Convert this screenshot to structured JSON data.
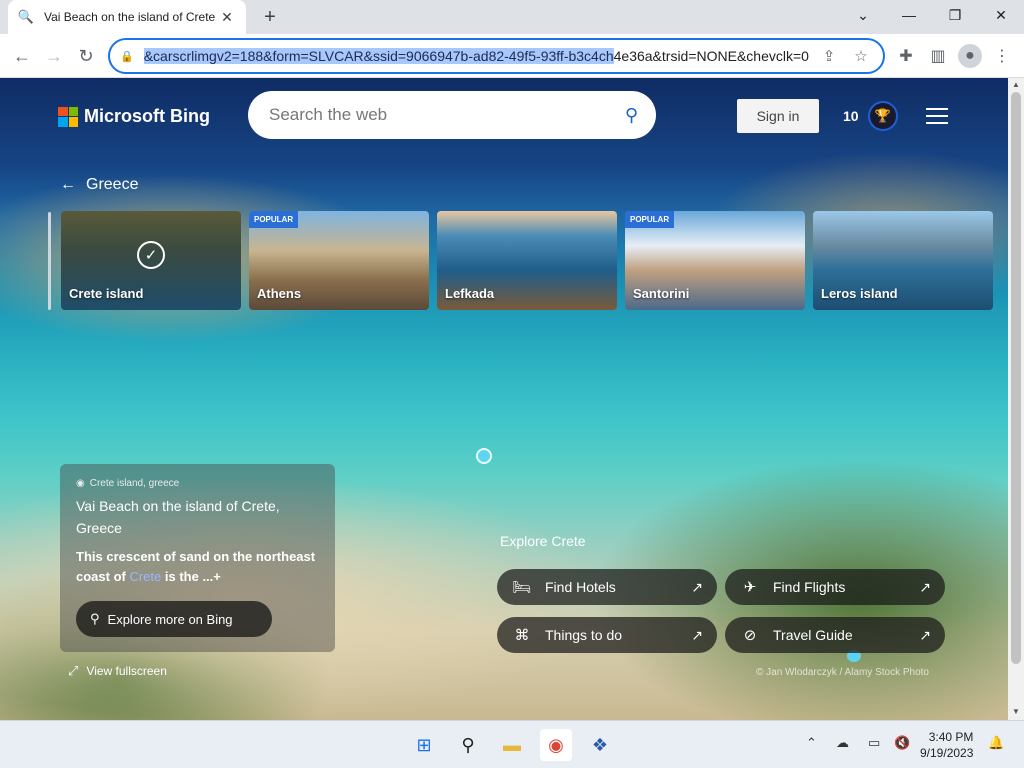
{
  "browser": {
    "tab_title": "Vai Beach on the island of Crete",
    "new_tab": "+",
    "url_selected": "&carscrlimgv2=188&form=SLVCAR&ssid=9066947b-ad82-49f5-93ff-b3c4ch",
    "url_rest": "4e36a&trsid=NONE&chevclk=0"
  },
  "bing": {
    "logo_text": "Microsoft Bing",
    "search_placeholder": "Search the web",
    "signin_label": "Sign in",
    "points": "10"
  },
  "carousel": {
    "title": "Greece",
    "items": [
      {
        "label": "Crete island",
        "badge": ""
      },
      {
        "label": "Athens",
        "badge": "POPULAR"
      },
      {
        "label": "Lefkada",
        "badge": ""
      },
      {
        "label": "Santorini",
        "badge": "POPULAR"
      },
      {
        "label": "Leros island",
        "badge": ""
      }
    ]
  },
  "info": {
    "location": "Crete island, greece",
    "title": "Vai Beach on the island of Crete, Greece",
    "desc_before": "This crescent of sand on the northeast coast of ",
    "desc_link": "Crete",
    "desc_after": " is the ...",
    "desc_more": "+",
    "explore_label": "Explore more on Bing",
    "fullscreen_label": "View fullscreen"
  },
  "explore": {
    "heading": "Explore Crete",
    "buttons": [
      {
        "label": "Find Hotels",
        "icon": "bed-icon"
      },
      {
        "label": "Find Flights",
        "icon": "plane-icon"
      },
      {
        "label": "Things to do",
        "icon": "binoculars-icon"
      },
      {
        "label": "Travel Guide",
        "icon": "compass-icon"
      }
    ]
  },
  "credit": "© Jan Wlodarczyk / Alamy Stock Photo",
  "taskbar": {
    "time": "3:40 PM",
    "date": "9/19/2023"
  },
  "colors": {
    "accent": "#1a73e8",
    "bing_blue": "#1a65c0",
    "popular_badge": "#2b6fd6"
  }
}
